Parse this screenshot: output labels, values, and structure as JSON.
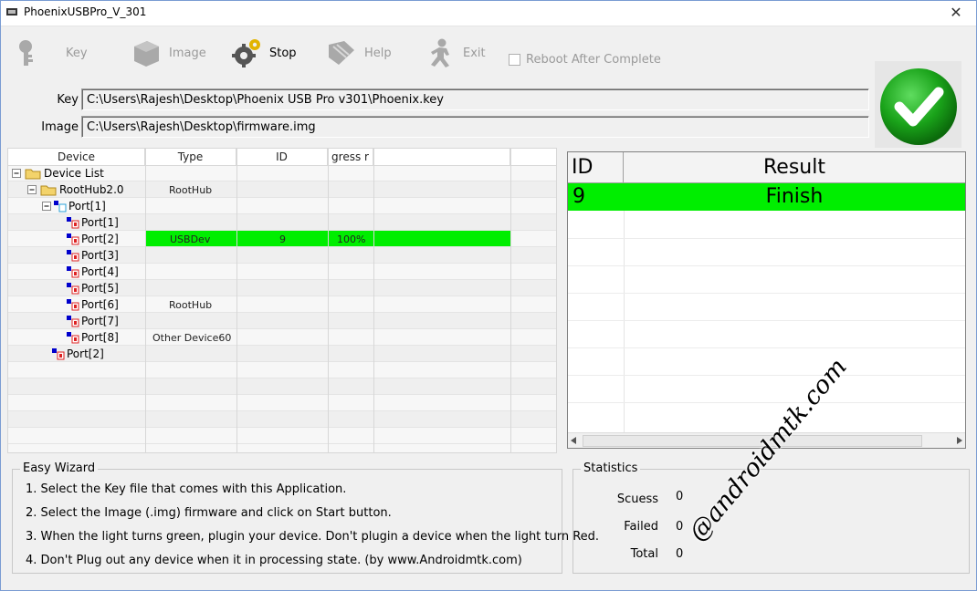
{
  "window": {
    "title": "PhoenixUSBPro_V_301",
    "close_glyph": "✕"
  },
  "toolbar": {
    "key": "Key",
    "image": "Image",
    "stop": "Stop",
    "help": "Help",
    "exit": "Exit",
    "reboot_label": "Reboot After Complete"
  },
  "paths": {
    "key_label": "Key",
    "key_value": "C:\\Users\\Rajesh\\Desktop\\Phoenix USB Pro v301\\Phoenix.key",
    "image_label": "Image",
    "image_value": "C:\\Users\\Rajesh\\Desktop\\firmware.img"
  },
  "device_grid": {
    "headers": [
      "Device",
      "Type",
      "ID",
      "gress r"
    ],
    "tree": [
      "Device List",
      "RootHub2.0",
      "Port[1]",
      "Port[1]",
      "Port[2]",
      "Port[3]",
      "Port[4]",
      "Port[5]",
      "Port[6]",
      "Port[7]",
      "Port[8]",
      "Port[2]"
    ],
    "cells": {
      "roothub_type": "RootHub",
      "usbdev_type": "USBDev",
      "usbdev_id": "9",
      "usbdev_progress": "100%",
      "port6_type": "RootHub",
      "port8_type": "Other Device60"
    }
  },
  "results": {
    "headers": [
      "ID",
      "Result"
    ],
    "rows": [
      {
        "id": "9",
        "result": "Finish"
      }
    ]
  },
  "wizard": {
    "title": "Easy Wizard",
    "steps": [
      "1. Select the Key file that comes with this Application.",
      "2. Select the Image (.img) firmware and click on Start button.",
      "3. When the light turns green, plugin your device. Don't plugin a device when the light turn Red.",
      "4. Don't Plug out any device when it in processing state. (by www.Androidmtk.com)"
    ]
  },
  "statistics": {
    "title": "Statistics",
    "success_label": "Scuess",
    "success_value": "0",
    "failed_label": "Failed",
    "failed_value": "0",
    "total_label": "Total",
    "total_value": "0"
  },
  "watermark": "@androidmtk.com",
  "colors": {
    "highlight": "#00ee00",
    "status_green": "#1aa31a"
  },
  "icons": [
    "app-icon",
    "key-icon",
    "image-icon",
    "gear-icon",
    "help-icon",
    "exit-icon",
    "checkmark-icon"
  ]
}
